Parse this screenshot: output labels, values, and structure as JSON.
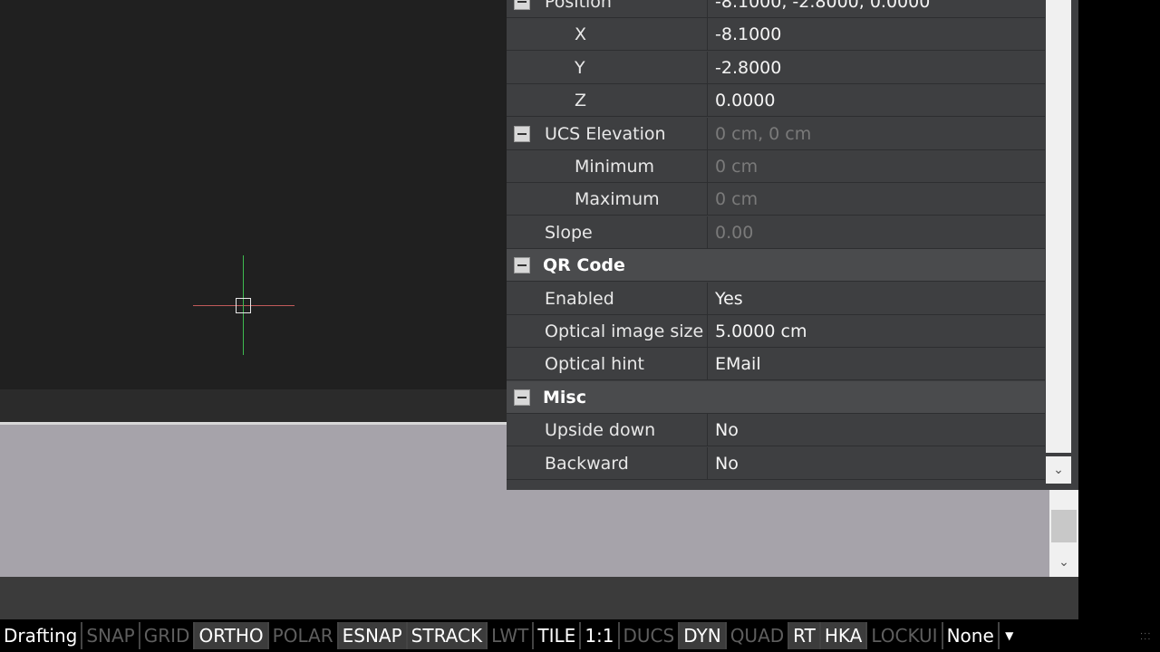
{
  "properties": {
    "rows": [
      {
        "type": "category",
        "label": "Position",
        "value": "-8.1000, -2.8000, 0.0000",
        "partial": true
      },
      {
        "type": "sub",
        "label": "X",
        "value": "-8.1000",
        "dim": false
      },
      {
        "type": "sub",
        "label": "Y",
        "value": "-2.8000",
        "dim": false
      },
      {
        "type": "sub",
        "label": "Z",
        "value": "0.0000",
        "dim": false
      },
      {
        "type": "category-plain",
        "label": "UCS Elevation",
        "value": "0 cm, 0 cm",
        "dim": true
      },
      {
        "type": "sub",
        "label": "Minimum",
        "value": "0 cm",
        "dim": true
      },
      {
        "type": "sub",
        "label": "Maximum",
        "value": "0 cm",
        "dim": true
      },
      {
        "type": "item",
        "label": "Slope",
        "value": "0.00",
        "dim": true
      },
      {
        "type": "header",
        "label": "QR Code"
      },
      {
        "type": "item",
        "label": "Enabled",
        "value": "Yes",
        "dim": false
      },
      {
        "type": "item",
        "label": "Optical image size",
        "value": "5.0000 cm",
        "dim": false
      },
      {
        "type": "item",
        "label": "Optical hint",
        "value": "EMail",
        "dim": false
      },
      {
        "type": "header",
        "label": "Misc"
      },
      {
        "type": "item",
        "label": "Upside down",
        "value": "No",
        "dim": false
      },
      {
        "type": "item",
        "label": "Backward",
        "value": "No",
        "dim": false
      }
    ],
    "scroll_down_icon": "chevron-down-icon"
  },
  "status_bar": {
    "items": [
      {
        "label": "Drafting",
        "state": "plain"
      },
      {
        "label": "SNAP",
        "state": "off"
      },
      {
        "label": "GRID",
        "state": "off"
      },
      {
        "label": "ORTHO",
        "state": "on"
      },
      {
        "label": "POLAR",
        "state": "off"
      },
      {
        "label": "ESNAP",
        "state": "on"
      },
      {
        "label": "STRACK",
        "state": "on"
      },
      {
        "label": "LWT",
        "state": "off"
      },
      {
        "label": "TILE",
        "state": "plain"
      },
      {
        "label": "1:1",
        "state": "plain"
      },
      {
        "label": "DUCS",
        "state": "off"
      },
      {
        "label": "DYN",
        "state": "on"
      },
      {
        "label": "QUAD",
        "state": "off"
      },
      {
        "label": "RT",
        "state": "on"
      },
      {
        "label": "HKA",
        "state": "on"
      },
      {
        "label": "LOCKUI",
        "state": "off"
      },
      {
        "label": "None",
        "state": "plain"
      }
    ],
    "menu_icon": "triangle-down-icon"
  },
  "colors": {
    "canvas": "#202020",
    "panel": "#3e3f41",
    "crosshair_x": "#c25a5a",
    "crosshair_y": "#3dbb4f",
    "command_area": "#a6a3aa"
  }
}
